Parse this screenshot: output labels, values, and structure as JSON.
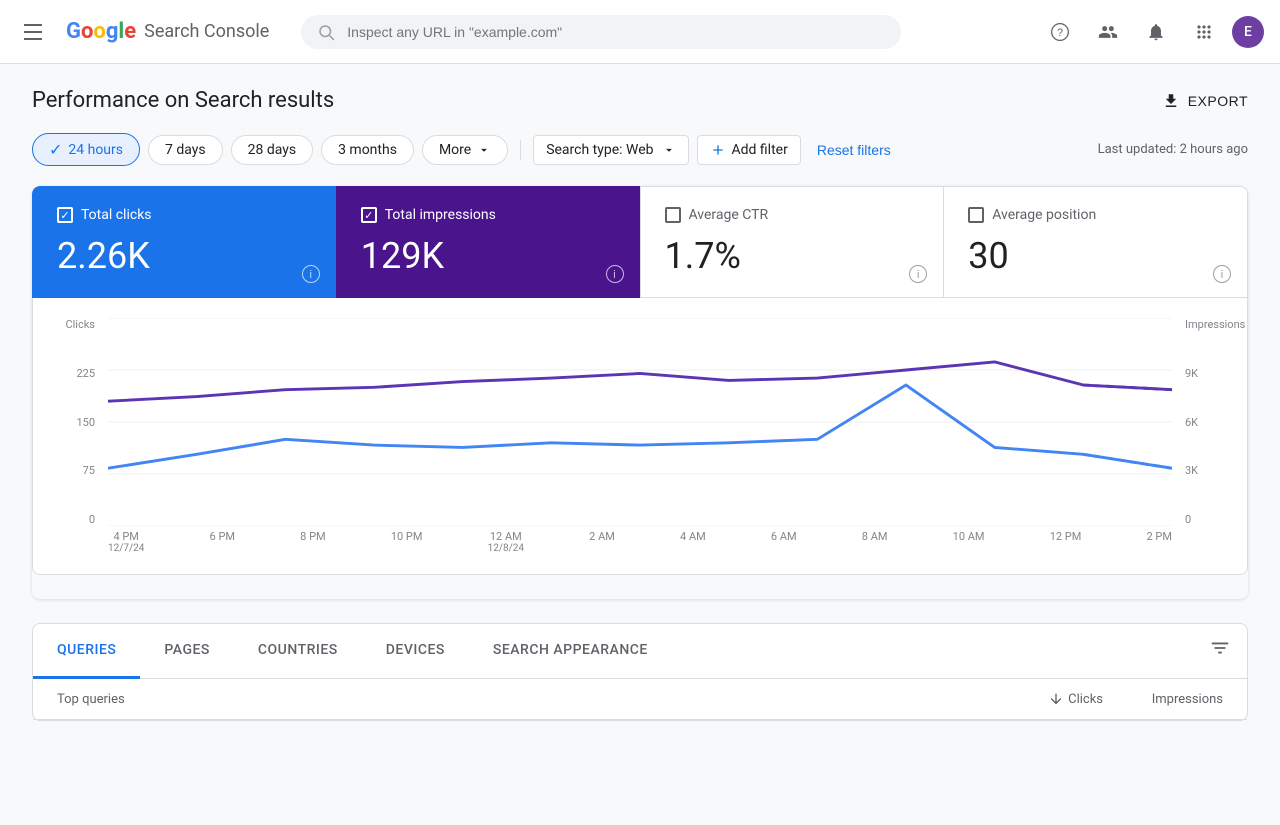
{
  "header": {
    "menu_icon": "menu",
    "logo": {
      "letters": [
        "G",
        "o",
        "o",
        "g",
        "l",
        "e"
      ],
      "app_name": "Search Console"
    },
    "search_placeholder": "Inspect any URL in \"example.com\"",
    "icons": {
      "help": "?",
      "users": "👥",
      "bell": "🔔",
      "grid": "⊞"
    },
    "avatar_letter": "E"
  },
  "page": {
    "title": "Performance on Search results",
    "export_label": "EXPORT"
  },
  "filters": {
    "time_filters": [
      {
        "id": "24h",
        "label": "24 hours",
        "active": true
      },
      {
        "id": "7d",
        "label": "7 days",
        "active": false
      },
      {
        "id": "28d",
        "label": "28 days",
        "active": false
      },
      {
        "id": "3m",
        "label": "3 months",
        "active": false
      },
      {
        "id": "more",
        "label": "More",
        "active": false
      }
    ],
    "search_type_label": "Search type: Web",
    "add_filter_label": "+ Add filter",
    "reset_label": "Reset filters",
    "last_updated": "Last updated: 2 hours ago"
  },
  "metrics": [
    {
      "id": "total-clicks",
      "label": "Total clicks",
      "value": "2.26K",
      "checked": true,
      "style": "active-blue"
    },
    {
      "id": "total-impressions",
      "label": "Total impressions",
      "value": "129K",
      "checked": true,
      "style": "active-purple"
    },
    {
      "id": "average-ctr",
      "label": "Average CTR",
      "value": "1.7%",
      "checked": false,
      "style": "inactive"
    },
    {
      "id": "average-position",
      "label": "Average position",
      "value": "30",
      "checked": false,
      "style": "inactive"
    }
  ],
  "chart": {
    "y_left_label": "Clicks",
    "y_right_label": "Impressions",
    "y_left_ticks": [
      "225",
      "150",
      "75",
      "0"
    ],
    "y_right_ticks": [
      "9K",
      "6K",
      "3K",
      "0"
    ],
    "x_ticks": [
      {
        "label": "4 PM",
        "sub": "12/7/24"
      },
      {
        "label": "6 PM",
        "sub": ""
      },
      {
        "label": "8 PM",
        "sub": ""
      },
      {
        "label": "10 PM",
        "sub": ""
      },
      {
        "label": "12 AM",
        "sub": "12/8/24"
      },
      {
        "label": "2 AM",
        "sub": ""
      },
      {
        "label": "4 AM",
        "sub": ""
      },
      {
        "label": "6 AM",
        "sub": ""
      },
      {
        "label": "8 AM",
        "sub": ""
      },
      {
        "label": "10 AM",
        "sub": ""
      },
      {
        "label": "12 PM",
        "sub": ""
      },
      {
        "label": "2 PM",
        "sub": ""
      }
    ]
  },
  "tabs": {
    "items": [
      {
        "id": "queries",
        "label": "QUERIES",
        "active": true
      },
      {
        "id": "pages",
        "label": "PAGES",
        "active": false
      },
      {
        "id": "countries",
        "label": "COUNTRIES",
        "active": false
      },
      {
        "id": "devices",
        "label": "DEVICES",
        "active": false
      },
      {
        "id": "search-appearance",
        "label": "SEARCH APPEARANCE",
        "active": false
      }
    ],
    "table_headers": {
      "query": "Top queries",
      "clicks": "Clicks",
      "impressions": "Impressions"
    }
  }
}
